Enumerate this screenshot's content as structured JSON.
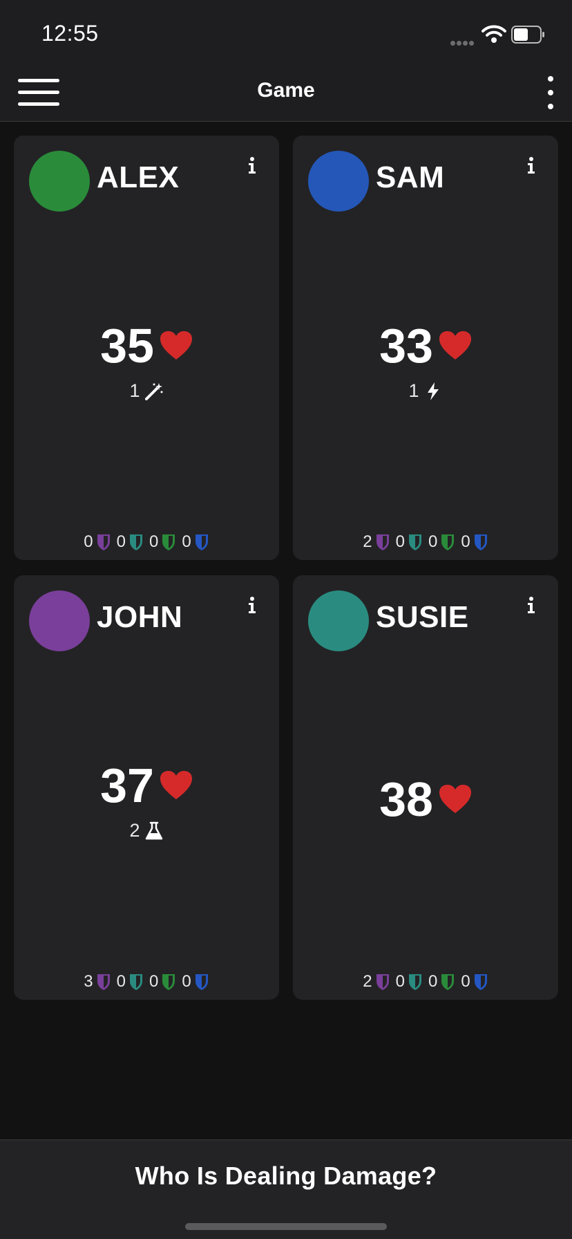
{
  "status_bar": {
    "time": "12:55"
  },
  "nav": {
    "title": "Game"
  },
  "colors": {
    "heart": "#d62a2a",
    "shield_purple": "#7a3f9a",
    "shield_teal": "#2a8c80",
    "shield_green": "#2a8c3a",
    "shield_blue": "#2457c4"
  },
  "players": [
    {
      "name": "ALEX",
      "avatar_color": "#2a8c3a",
      "life": "35",
      "sub_value": "1",
      "sub_icon": "magic-wand-icon",
      "counters": [
        "0",
        "0",
        "0",
        "0"
      ]
    },
    {
      "name": "SAM",
      "avatar_color": "#2457b8",
      "life": "33",
      "sub_value": "1",
      "sub_icon": "lightning-bolt-icon",
      "counters": [
        "2",
        "0",
        "0",
        "0"
      ]
    },
    {
      "name": "JOHN",
      "avatar_color": "#7a3f9a",
      "life": "37",
      "sub_value": "2",
      "sub_icon": "flask-icon",
      "counters": [
        "3",
        "0",
        "0",
        "0"
      ]
    },
    {
      "name": "SUSIE",
      "avatar_color": "#2a8c80",
      "life": "38",
      "counters": [
        "2",
        "0",
        "0",
        "0"
      ]
    }
  ],
  "bottom": {
    "action_label": "Who Is Dealing Damage?"
  }
}
